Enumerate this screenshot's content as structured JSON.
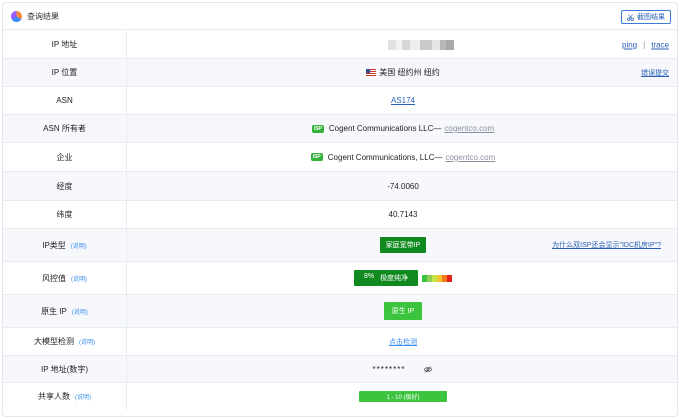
{
  "header": {
    "title": "查询结果",
    "screenshot_button": "截图结果"
  },
  "rows": {
    "ip": {
      "label": "IP 地址",
      "links": [
        "ping",
        "trace"
      ],
      "separator": "|"
    },
    "location": {
      "label": "IP 位置",
      "value": "美国 纽约州 纽约",
      "report": "错误提交",
      "flag_icon": "us-flag-icon"
    },
    "asn": {
      "label": "ASN",
      "value": "AS174"
    },
    "asn_owner": {
      "label": "ASN 所有者",
      "badge": "ISP",
      "name": "Cogent Communications LLC—",
      "domain": "cogentco.com"
    },
    "company": {
      "label": "企业",
      "badge": "ISP",
      "name": "Cogent Communications, LLC—",
      "domain": "cogentco.com"
    },
    "longitude": {
      "label": "经度",
      "value": "-74.0060"
    },
    "latitude": {
      "label": "纬度",
      "value": "40.7143"
    },
    "ip_type": {
      "label": "IP类型",
      "help": "(说明)",
      "value": "家庭宽带IP",
      "link": "为什么双ISP还会显示\"IDC机房IP\"?"
    },
    "risk": {
      "label": "风控值",
      "help": "(说明)",
      "percent": "8%",
      "text": "极度纯净",
      "level_fraction": 0.08,
      "colors": [
        "#3cc43e",
        "#8fd14f",
        "#c7e34a",
        "#f4c430",
        "#f07a1a",
        "#e0241b"
      ]
    },
    "native": {
      "label": "原生 IP",
      "help": "(说明)",
      "value": "原生 IP"
    },
    "llm": {
      "label": "大模型检测",
      "help": "(说明)",
      "value": "点击检测"
    },
    "ip_numeric": {
      "label": "IP 地址(数字)",
      "value": "********",
      "icon": "eye-hidden-icon"
    },
    "sharing": {
      "label": "共享人数",
      "help": "(说明)",
      "value": "1 - 10 (极好)"
    }
  }
}
